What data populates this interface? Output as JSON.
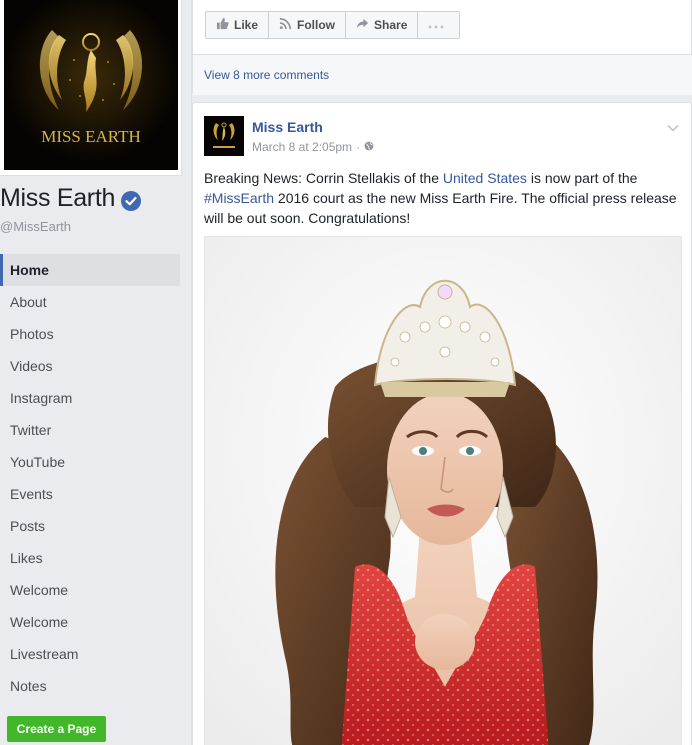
{
  "page": {
    "name": "Miss Earth",
    "handle": "@MissEarth",
    "logo_text": "MISS EARTH"
  },
  "nav": {
    "items": [
      {
        "label": "Home"
      },
      {
        "label": "About"
      },
      {
        "label": "Photos"
      },
      {
        "label": "Videos"
      },
      {
        "label": "Instagram"
      },
      {
        "label": "Twitter"
      },
      {
        "label": "YouTube"
      },
      {
        "label": "Events"
      },
      {
        "label": "Posts"
      },
      {
        "label": "Likes"
      },
      {
        "label": "Welcome"
      },
      {
        "label": "Welcome"
      },
      {
        "label": "Livestream"
      },
      {
        "label": "Notes"
      }
    ],
    "create_page_label": "Create a Page"
  },
  "prev_post": {
    "actions": {
      "like": "Like",
      "follow": "Follow",
      "share": "Share"
    },
    "more_comments": "View 8 more comments"
  },
  "post": {
    "author": "Miss Earth",
    "time": "March 8 at 2:05pm",
    "separator": "·",
    "text_1": "Breaking News: Corrin Stellakis of the ",
    "link_1": "United States",
    "text_2": " is now part of the ",
    "link_2": "#MissEarth",
    "text_3": " 2016 court as the new Miss Earth Fire. The official press release will be out soon. Congratulations!"
  },
  "colors": {
    "link": "#365899",
    "accent": "#4267b2",
    "create_button": "#42b72a",
    "dress": "#c8201f"
  },
  "icons": {
    "verified": "verified-badge-icon",
    "like": "thumbs-up-icon",
    "follow": "rss-icon",
    "share": "share-arrow-icon",
    "more": "ellipsis-icon",
    "globe": "globe-icon",
    "chevron": "chevron-down-icon"
  }
}
